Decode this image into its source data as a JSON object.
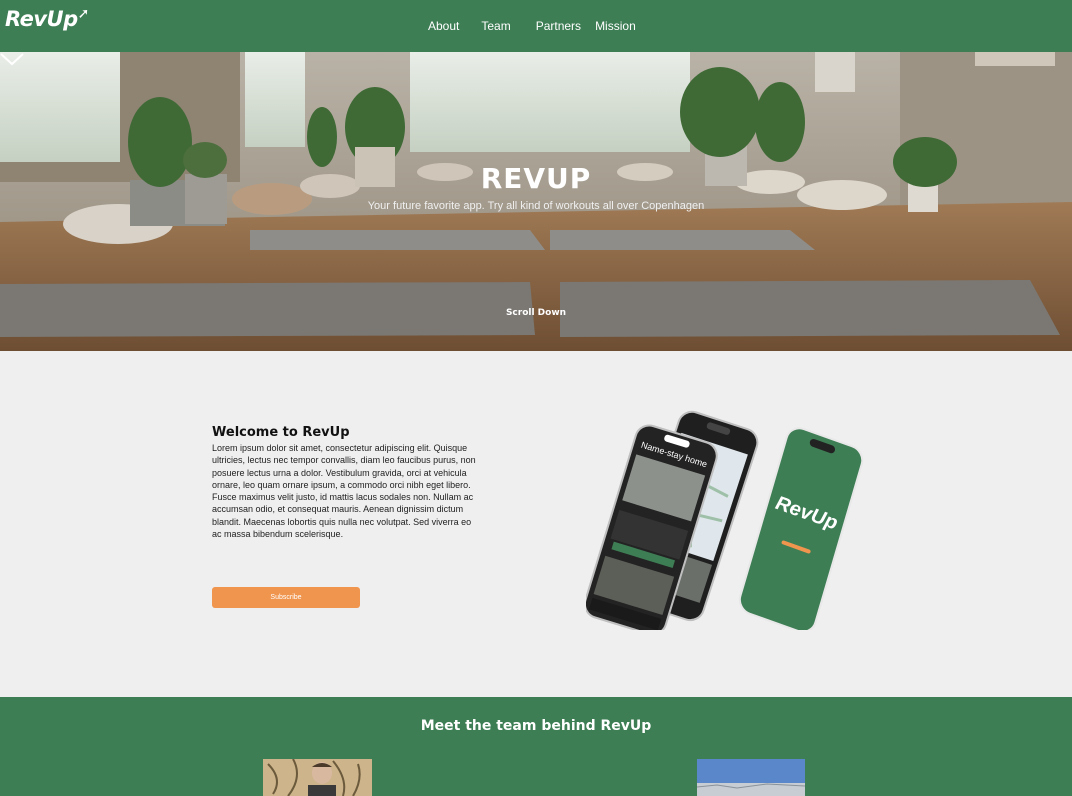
{
  "brand": {
    "logo_text": "RevUp",
    "colors": {
      "primary": "#3e7e55",
      "accent": "#f0954e",
      "background": "#efefef"
    }
  },
  "nav": {
    "items": [
      "About",
      "Team",
      "Partners",
      "Mission"
    ]
  },
  "hero": {
    "title": "REVUP",
    "subtitle": "Your future favorite app. Try all kind of workouts all over Copenhagen",
    "scroll_label": "Scroll Down"
  },
  "welcome": {
    "heading": "Welcome to RevUp",
    "body": "Lorem ipsum dolor sit amet, consectetur adipiscing elit. Quisque ultricies, lectus nec tempor convallis, diam leo faucibus purus, non posuere lectus urna a dolor. Vestibulum gravida, orci at vehicula ornare, leo quam ornare ipsum, a commodo orci nibh eget libero. Fusce maximus velit justo, id mattis lacus sodales non. Nullam ac accumsan odio, et consequat mauris. Aenean dignissim dictum blandit. Maecenas lobortis quis nulla nec volutpat. Sed viverra eo ac massa bibendum scelerisque.",
    "subscribe_label": "Subscribe"
  },
  "phones": {
    "screen_title": "Name-stay home",
    "splash_logo": "RevUp"
  },
  "team": {
    "heading": "Meet the team behind RevUp"
  }
}
